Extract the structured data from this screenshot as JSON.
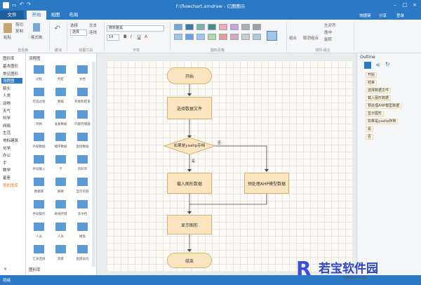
{
  "title": "F:\\flowchart.amdraw - 亿图图示",
  "menus": [
    "文件",
    "开始",
    "视图",
    "布局"
  ],
  "user": {
    "feedback": "快捷键",
    "share": "分享",
    "login": "登录"
  },
  "ribbon": {
    "clipboard": {
      "paste": "粘贴",
      "cut": "剪切",
      "copy": "复制",
      "fmt": "格式刷",
      "label": "剪贴板"
    },
    "undo": {
      "label": "撤消"
    },
    "tools": {
      "select": "选择",
      "text": "文本",
      "connector": "连线",
      "label": "绘图工具",
      "select_box": "选择"
    },
    "font": {
      "family": "微软雅黑",
      "size": "14",
      "label": "字体"
    },
    "style": {
      "label": "图形风格",
      "colors": [
        "#6fa8dc",
        "#3f77a8",
        "#7bb3a9",
        "#4a8c88",
        "#f4a6b8",
        "#c8a2e0",
        "#b0b0b0",
        "#a0a0a0",
        "#9fc5e8",
        "#6d9eeb",
        "#a4c2f4",
        "#b7d7a8",
        "#ea9999",
        "#d5a6bd",
        "#cccccc",
        "#b3c7dc"
      ]
    },
    "arrange": {
      "group": "组合",
      "ungroup": "取消组合",
      "align": "左对齐",
      "distribute": "居中",
      "rotate": "旋转",
      "label": "排列·组合"
    }
  },
  "categories": [
    "基本图形",
    "常见图形",
    "流程图",
    "箭头",
    "人类",
    "动物",
    "天气",
    "科学",
    "网络",
    "生活",
    "地标建筑",
    "化学",
    "办公",
    "手",
    "数学",
    "星座",
    "我的图库"
  ],
  "shapes_header": {
    "left": "图形库",
    "right": "流程图"
  },
  "shapes": [
    "过程",
    "判定",
    "文档",
    "可选过程",
    "数据",
    "开始和结束",
    "开始",
    "准备数据",
    "内部存储器",
    "外部数据",
    "顺序数据",
    "直接数据",
    "手动输入",
    "卡",
    "资料带",
    "数据库",
    "摘要",
    "显示内容",
    "手动操作",
    "离线存储",
    "多文档",
    "人员",
    "人员",
    "磁盘",
    "汇总连接",
    "或者",
    "直接访问"
  ],
  "library_tab": "图形库",
  "flow": {
    "start": "开始",
    "select": "选择数据文件",
    "decision": "如果是yaahp存档",
    "load": "载入图形数据",
    "preprocess": "预处理AHP模型数据",
    "show": "显示图形",
    "end": "结束",
    "yes": "是",
    "no": "否"
  },
  "outline": {
    "title": "Outline",
    "items": [
      "开始",
      "结束",
      "选择数据文件",
      "载入图形数据",
      "预处理AHP模型数据",
      "显示图形",
      "如果是yaahp存档",
      "是",
      "否"
    ]
  },
  "status": "就绪",
  "watermark": {
    "name": "若宝软件园",
    "url": "RJBSCN.COM"
  }
}
